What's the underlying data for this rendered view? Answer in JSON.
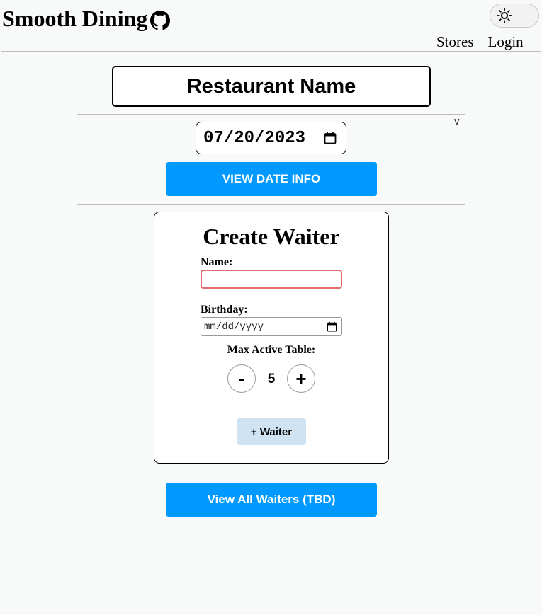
{
  "header": {
    "title": "Smooth Dining",
    "nav": [
      {
        "label": "Stores"
      },
      {
        "label": "Login"
      }
    ]
  },
  "restaurant": {
    "name": "Restaurant Name"
  },
  "date_picker": {
    "value": "07/20/2023"
  },
  "buttons": {
    "view_date_info": "VIEW DATE INFO",
    "view_all_waiters": "View All Waiters (TBD)"
  },
  "create_waiter": {
    "title": "Create Waiter",
    "name_label": "Name:",
    "name_value": "",
    "birthday_label": "Birthday:",
    "birthday_placeholder": "mm/dd/yyyy",
    "max_label": "Max Active Table:",
    "minus_label": "-",
    "plus_label": "+",
    "max_value": "5",
    "submit_label": "+ Waiter"
  },
  "colors": {
    "primary": "#0099ff",
    "secondary_button": "#cfe3f2",
    "error_border": "#e46b6b",
    "background": "#f8faf9"
  }
}
